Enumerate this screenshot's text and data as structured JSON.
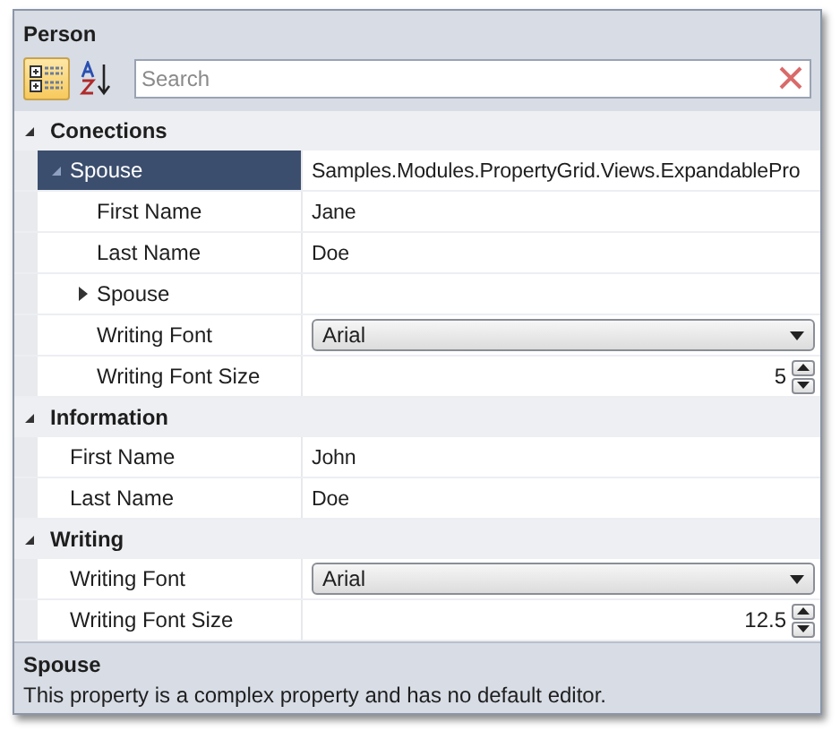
{
  "title": "Person",
  "toolbar": [
    {
      "kind": "categorized",
      "selected": true
    },
    {
      "kind": "alphabetical",
      "selected": false
    }
  ],
  "search": {
    "placeholder": "Search"
  },
  "categories": [
    {
      "name": "Conections",
      "expanded": true,
      "properties": [
        {
          "kind": "complex",
          "name": "Spouse",
          "selected": true,
          "expanded": true,
          "value": "Samples.Modules.PropertyGrid.Views.ExpandablePro",
          "children": [
            {
              "kind": "text",
              "name": "First Name",
              "selected": false,
              "value": "Jane"
            },
            {
              "kind": "text",
              "name": "Last Name",
              "selected": false,
              "value": "Doe"
            },
            {
              "kind": "complex",
              "name": "Spouse",
              "selected": false,
              "expanded": false
            },
            {
              "kind": "dropdown",
              "name": "Writing Font",
              "selected": false,
              "value": "Arial"
            },
            {
              "kind": "spinner",
              "name": "Writing Font Size",
              "selected": false,
              "value": "5"
            }
          ]
        }
      ]
    },
    {
      "name": "Information",
      "expanded": true,
      "properties": [
        {
          "kind": "text",
          "name": "First Name",
          "selected": false,
          "value": "John"
        },
        {
          "kind": "text",
          "name": "Last Name",
          "selected": false,
          "value": "Doe"
        }
      ]
    },
    {
      "name": "Writing",
      "expanded": true,
      "properties": [
        {
          "kind": "dropdown",
          "name": "Writing Font",
          "selected": false,
          "value": "Arial"
        },
        {
          "kind": "spinner",
          "name": "Writing Font Size",
          "selected": false,
          "value": "12.5"
        }
      ]
    }
  ],
  "description": {
    "title": "Spouse",
    "text": "This property is a complex property and has no default editor."
  }
}
